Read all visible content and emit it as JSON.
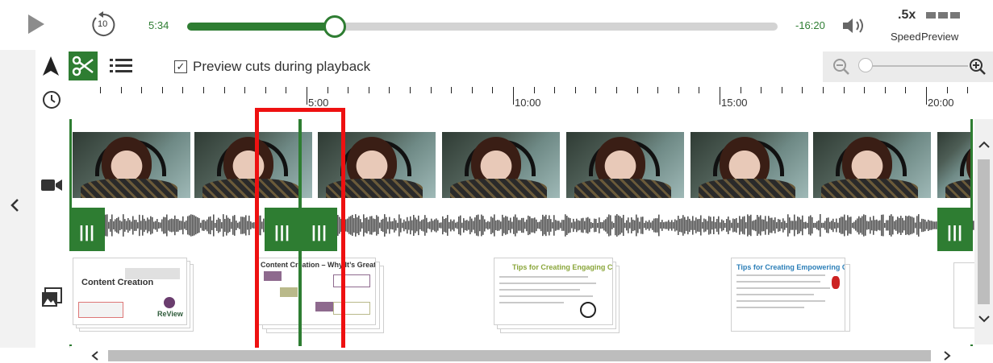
{
  "player": {
    "elapsed": "5:34",
    "remaining": "-16:20",
    "progress_fraction": 0.25,
    "skip_back_seconds": "10",
    "speed_value": ".5x",
    "speed_label": "Speed",
    "preview_label": "Preview"
  },
  "toolbar": {
    "preview_cuts_label": "Preview cuts during playback",
    "preview_cuts_checked": true,
    "zoom_fraction": 0.0
  },
  "ruler": {
    "labels": [
      "5:00",
      "10:00",
      "15:00",
      "20:00"
    ]
  },
  "slides": [
    {
      "title": "Content Creation",
      "logo_text": "ReView"
    },
    {
      "title": "Content Creation – Why It’s Great"
    },
    {
      "title": "Tips for Creating Engaging Content"
    },
    {
      "title": "Tips for Creating Empowering Content"
    }
  ],
  "colors": {
    "accent": "#2e7d32",
    "highlight": "#ee1111"
  },
  "icons": {
    "play": "play-icon",
    "skip_back": "rewind-10-icon",
    "volume": "volume-icon",
    "preview": "preview-icon",
    "select": "arrow-cursor-icon",
    "cut": "scissors-icon",
    "list": "list-icon",
    "clock": "clock-icon",
    "video": "video-camera-icon",
    "slides": "image-gallery-icon",
    "zoom_out": "zoom-out-icon",
    "zoom_in": "zoom-in-icon"
  }
}
